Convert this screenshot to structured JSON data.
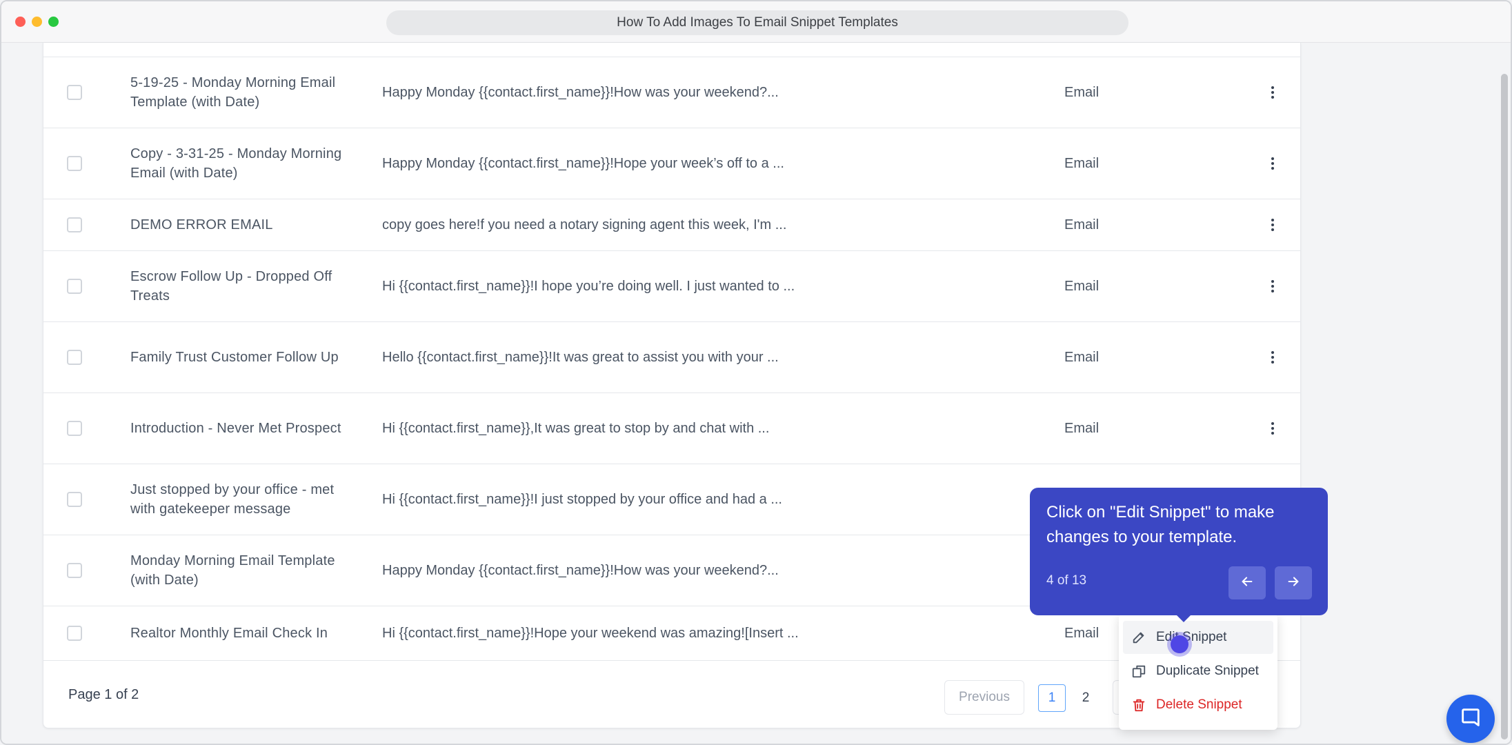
{
  "browser": {
    "title": "How To Add Images To Email Snippet Templates"
  },
  "rows": [
    {
      "name": "5-19-25 - Monday Morning Email Template (with Date)",
      "body": "Happy Monday {{contact.first_name}}!How was your weekend?...",
      "type": "Email"
    },
    {
      "name": "Copy - 3-31-25 - Monday Morning Email (with Date)",
      "body": "Happy Monday {{contact.first_name}}!Hope your week’s off to a ...",
      "type": "Email"
    },
    {
      "name": "DEMO ERROR EMAIL",
      "body": "copy goes here!f you need a notary signing agent this week, I'm ...",
      "type": "Email"
    },
    {
      "name": "Escrow Follow Up - Dropped Off Treats",
      "body": "Hi {{contact.first_name}}!I hope you’re doing well. I just wanted to ...",
      "type": "Email"
    },
    {
      "name": "Family Trust Customer Follow Up",
      "body": "Hello {{contact.first_name}}!It was great to assist you with your ...",
      "type": "Email"
    },
    {
      "name": "Introduction - Never Met Prospect",
      "body": "Hi {{contact.first_name}},It was great to stop by and chat with ...",
      "type": "Email"
    },
    {
      "name": "Just stopped by your office - met with gatekeeper message",
      "body": "Hi {{contact.first_name}}!I just stopped by your office and had a ...",
      "type": ""
    },
    {
      "name": "Monday Morning Email Template (with Date)",
      "body": "Happy Monday {{contact.first_name}}!How was your weekend?...",
      "type": ""
    },
    {
      "name": "Realtor Monthly Email Check In",
      "body": "Hi {{contact.first_name}}!Hope your weekend was amazing![Insert ...",
      "type": "Email"
    }
  ],
  "pagination": {
    "info": "Page 1 of 2",
    "previous": "Previous",
    "current": "1",
    "other": "2"
  },
  "menu": {
    "edit": "Edit Snippet",
    "duplicate": "Duplicate Snippet",
    "delete": "Delete Snippet"
  },
  "tooltip": {
    "text": "Click on \"Edit Snippet\" to make changes to your template.",
    "step": "4 of 13"
  },
  "colors": {
    "tooltip_bg": "#3b47c4",
    "danger": "#dc2626",
    "accent": "#2563eb"
  },
  "icons": [
    "kebab-menu-icon",
    "pencil-icon",
    "duplicate-icon",
    "trash-icon",
    "arrow-left-icon",
    "arrow-right-icon",
    "chat-icon"
  ]
}
